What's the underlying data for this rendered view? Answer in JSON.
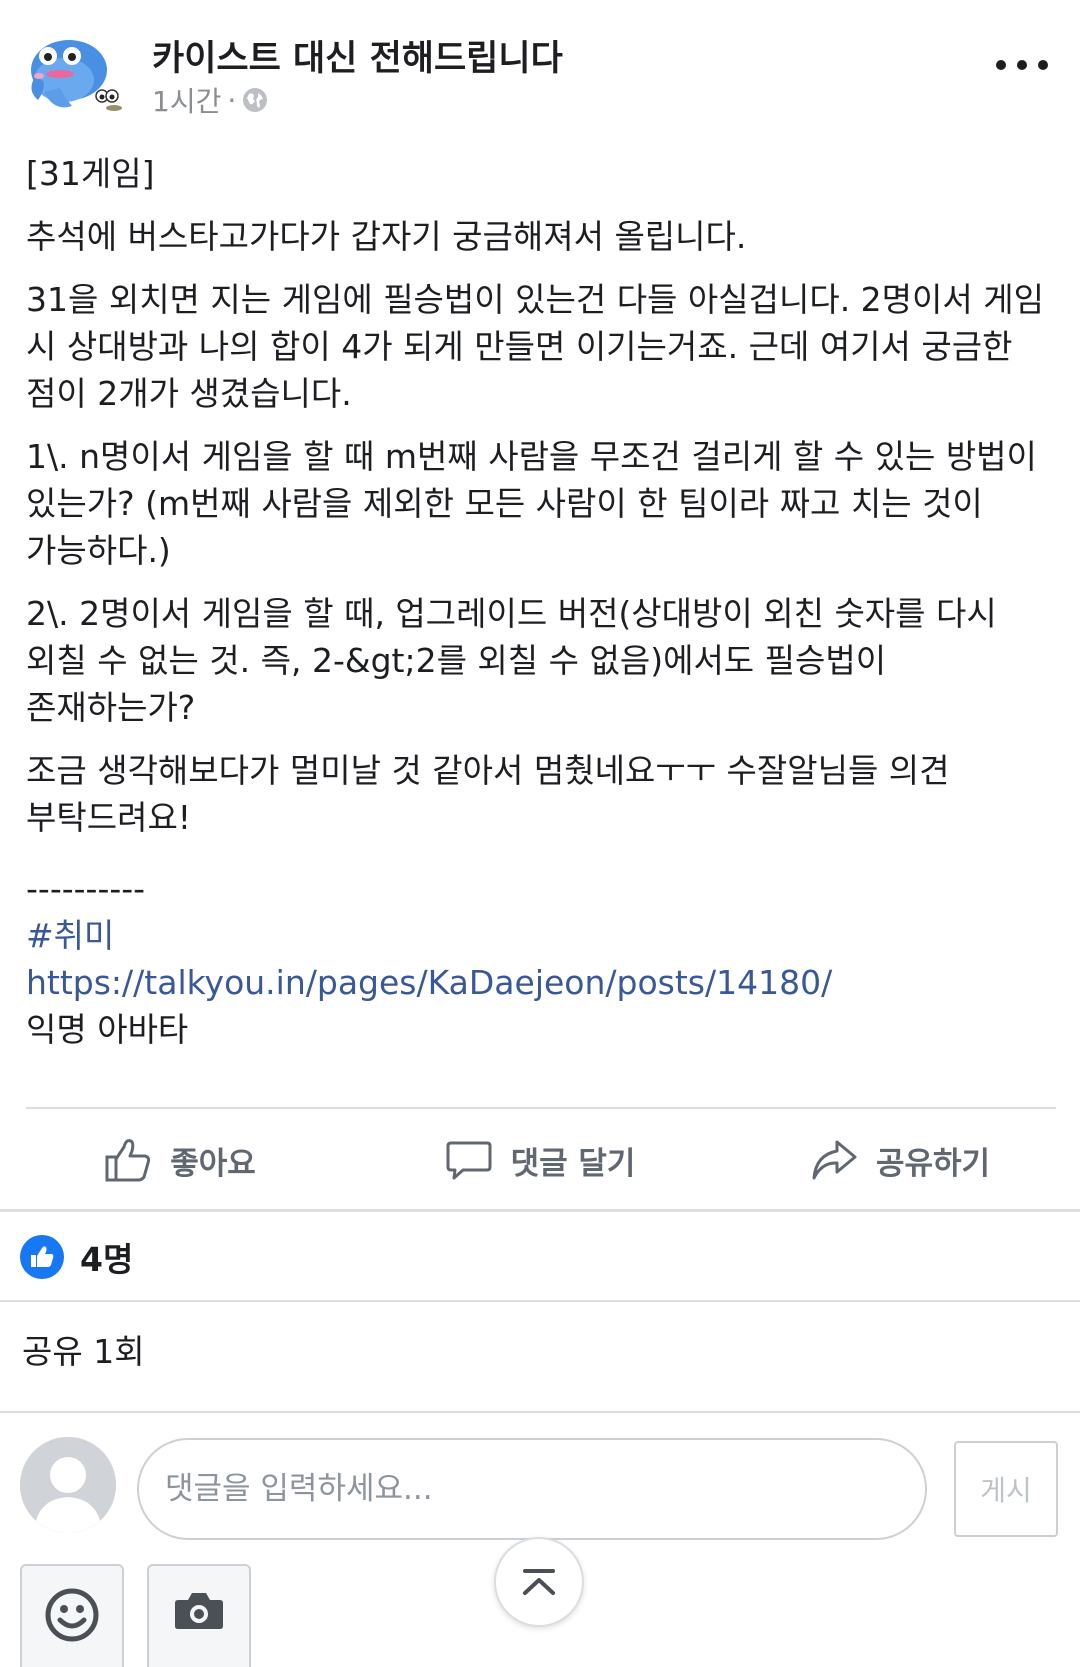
{
  "header": {
    "page_name": "카이스트 대신 전해드립니다",
    "time": "1시간",
    "separator": "·",
    "privacy_icon": "globe-icon",
    "more_icon": "more-dots-icon"
  },
  "post": {
    "paragraphs": [
      "[31게임]",
      "추석에 버스타고가다가 갑자기 궁금해져서 올립니다.",
      "31을 외치면 지는 게임에 필승법이 있는건 다들 아실겁니다. 2명이서 게임 시 상대방과 나의 합이 4가 되게 만들면 이기는거죠. 근데 여기서 궁금한 점이 2개가 생겼습니다.",
      "1\\. n명이서 게임을 할 때 m번째 사람을 무조건 걸리게 할 수 있는 방법이 있는가? (m번째 사람을 제외한 모든 사람이 한 팀이라 짜고 치는 것이 가능하다.)",
      "2\\. 2명이서 게임을 할 때, 업그레이드 버전(상대방이 외친 숫자를 다시 외칠 수 없는 것. 즉, 2-&gt;2를 외칠 수 없음)에서도 필승법이 존재하는가?",
      "조금 생각해보다가 멀미날 것 같아서 멈췄네요ㅜㅜ 수잘알님들 의견 부탁드려요!"
    ],
    "separator": "----------",
    "hashtag": "#취미",
    "link": "https://talkyou.in/pages/KaDaejeon/posts/14180/",
    "author": "익명 아바타"
  },
  "actions": {
    "like": "좋아요",
    "comment": "댓글 달기",
    "share": "공유하기"
  },
  "reactions": {
    "count": "4명"
  },
  "shares": {
    "text": "공유 1회"
  },
  "composer": {
    "placeholder": "댓글을 입력하세요...",
    "post_button": "게시"
  },
  "colors": {
    "link": "#385898",
    "like_blue": "#1877f2",
    "divider": "#dadde1"
  }
}
